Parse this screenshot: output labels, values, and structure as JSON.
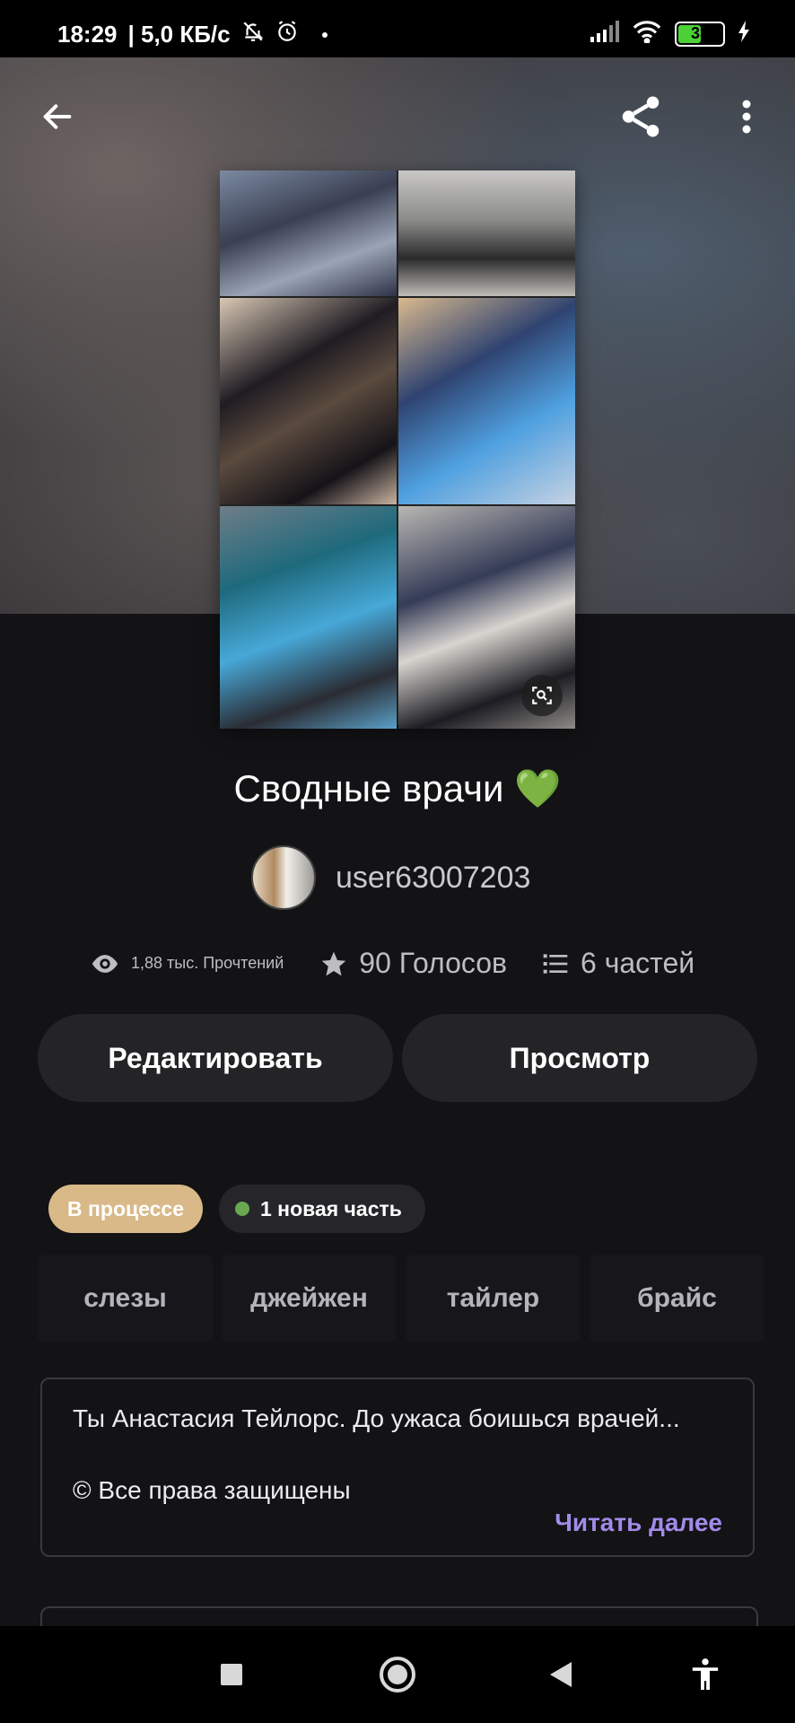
{
  "status_bar": {
    "time": "18:29",
    "network_speed": "| 5,0 КБ/с",
    "battery": "33",
    "icons": [
      "mute-bell-icon",
      "alarm-icon",
      "dot-icon",
      "signal-icon",
      "wifi-icon",
      "battery-icon",
      "charging-icon"
    ]
  },
  "header": {
    "back_icon": "arrow-left-icon",
    "share_icon": "share-icon",
    "menu_icon": "more-vertical-icon"
  },
  "story": {
    "title": "Сводные врачи 💚",
    "author": "user63007203",
    "reads": "1,88 тыс. Прочтений",
    "votes": "90 Голосов",
    "parts": "6 частей"
  },
  "actions": {
    "edit_label": "Редактировать",
    "view_label": "Просмотр"
  },
  "chips": {
    "status": "В процессе",
    "new_part": "1 новая часть"
  },
  "tags": [
    "слезы",
    "джейжен",
    "тайлер",
    "брайс"
  ],
  "description": {
    "text": "Ты Анастасия Тейлорс. До ужаса боишься врачей...",
    "rights": "© Все права защищены",
    "read_more": "Читать далее"
  },
  "colors": {
    "background": "#131215",
    "status_chip": "#d9b988",
    "new_dot": "#6aa84f",
    "link": "#a18be8"
  }
}
